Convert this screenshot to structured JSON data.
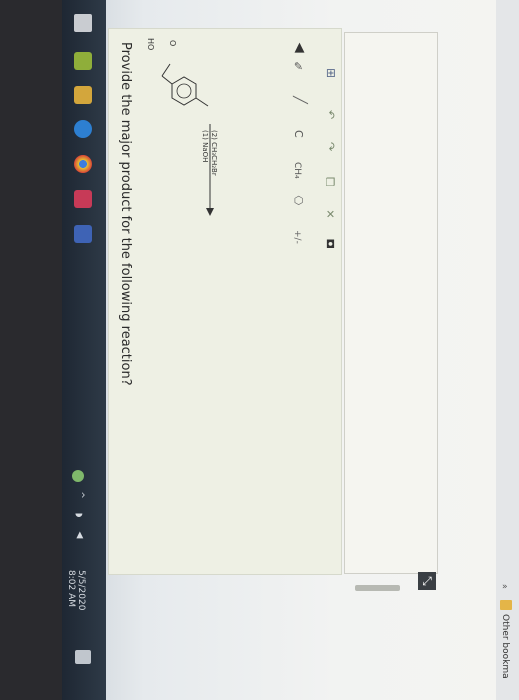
{
  "question": {
    "prompt": "Provide the major product for the following reaction?",
    "ho": "HO",
    "o": "O",
    "reagents": [
      "(1) NaOH",
      "(2) CH₃CH₂Br"
    ]
  },
  "tools": {
    "charge": "+/-",
    "ch4": "CH₄",
    "carbon": "C"
  },
  "taskbar": {
    "time": "8:02 AM",
    "date": "5/5/2020"
  },
  "bookmarks": {
    "other": "Other bookma"
  },
  "colors": {
    "panel": "#eef0e4",
    "canvas": "#f5f5f0"
  }
}
